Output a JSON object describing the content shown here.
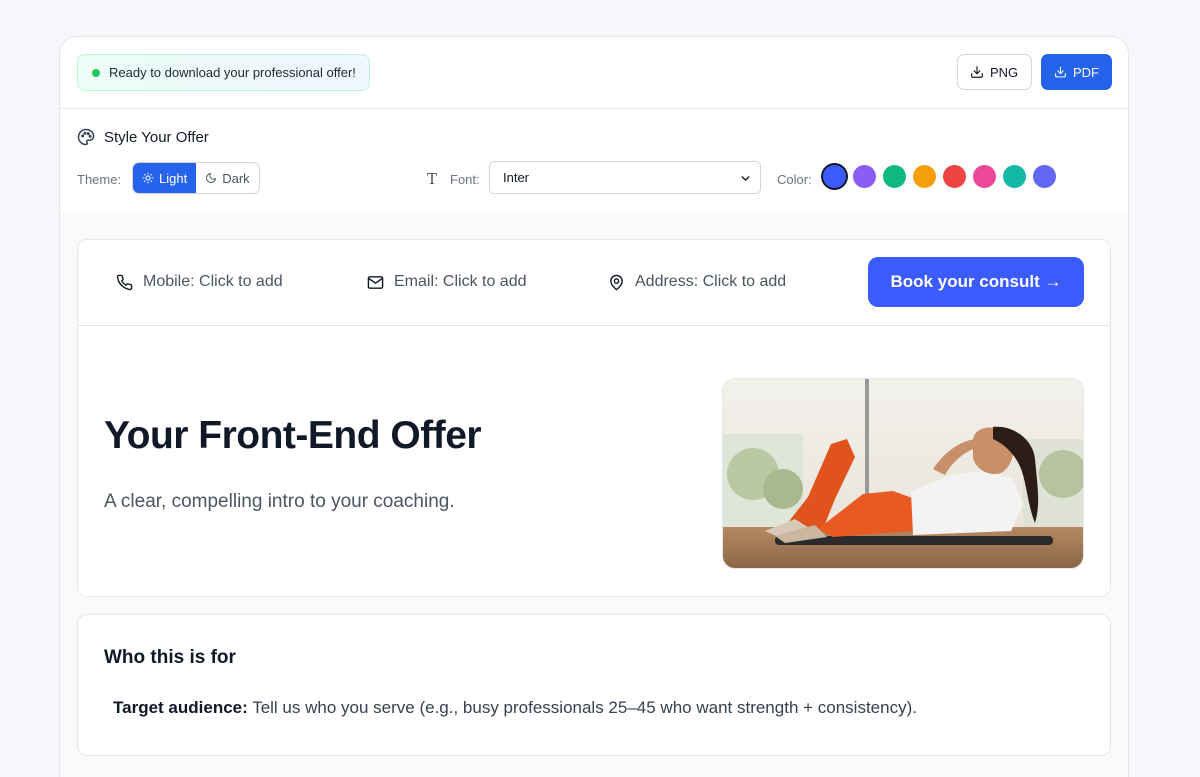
{
  "status": {
    "text": "Ready to download your professional offer!"
  },
  "downloads": {
    "png_label": "PNG",
    "pdf_label": "PDF"
  },
  "style": {
    "title": "Style Your Offer",
    "theme_label": "Theme:",
    "theme_options": [
      "Light",
      "Dark"
    ],
    "theme_selected": "Light",
    "font_label": "Font:",
    "font_value": "Inter",
    "color_label": "Color:",
    "colors": [
      "#3b5bfd",
      "#8b5cf6",
      "#10b981",
      "#f59e0b",
      "#ef4444",
      "#ec4899",
      "#14b8a6",
      "#6366f1"
    ],
    "selected_color": "#3b5bfd"
  },
  "contact": {
    "mobile": "Mobile: Click to add",
    "email": "Email: Click to add",
    "address": "Address: Click to add",
    "cta": "Book your consult →"
  },
  "hero": {
    "title": "Your Front-End Offer",
    "subtitle": "A clear, compelling intro to your coaching."
  },
  "audience": {
    "title": "Who this is for",
    "label": "Target audience:",
    "text": "Tell us who you serve (e.g., busy professionals 25–45 who want strength + consistency)."
  }
}
